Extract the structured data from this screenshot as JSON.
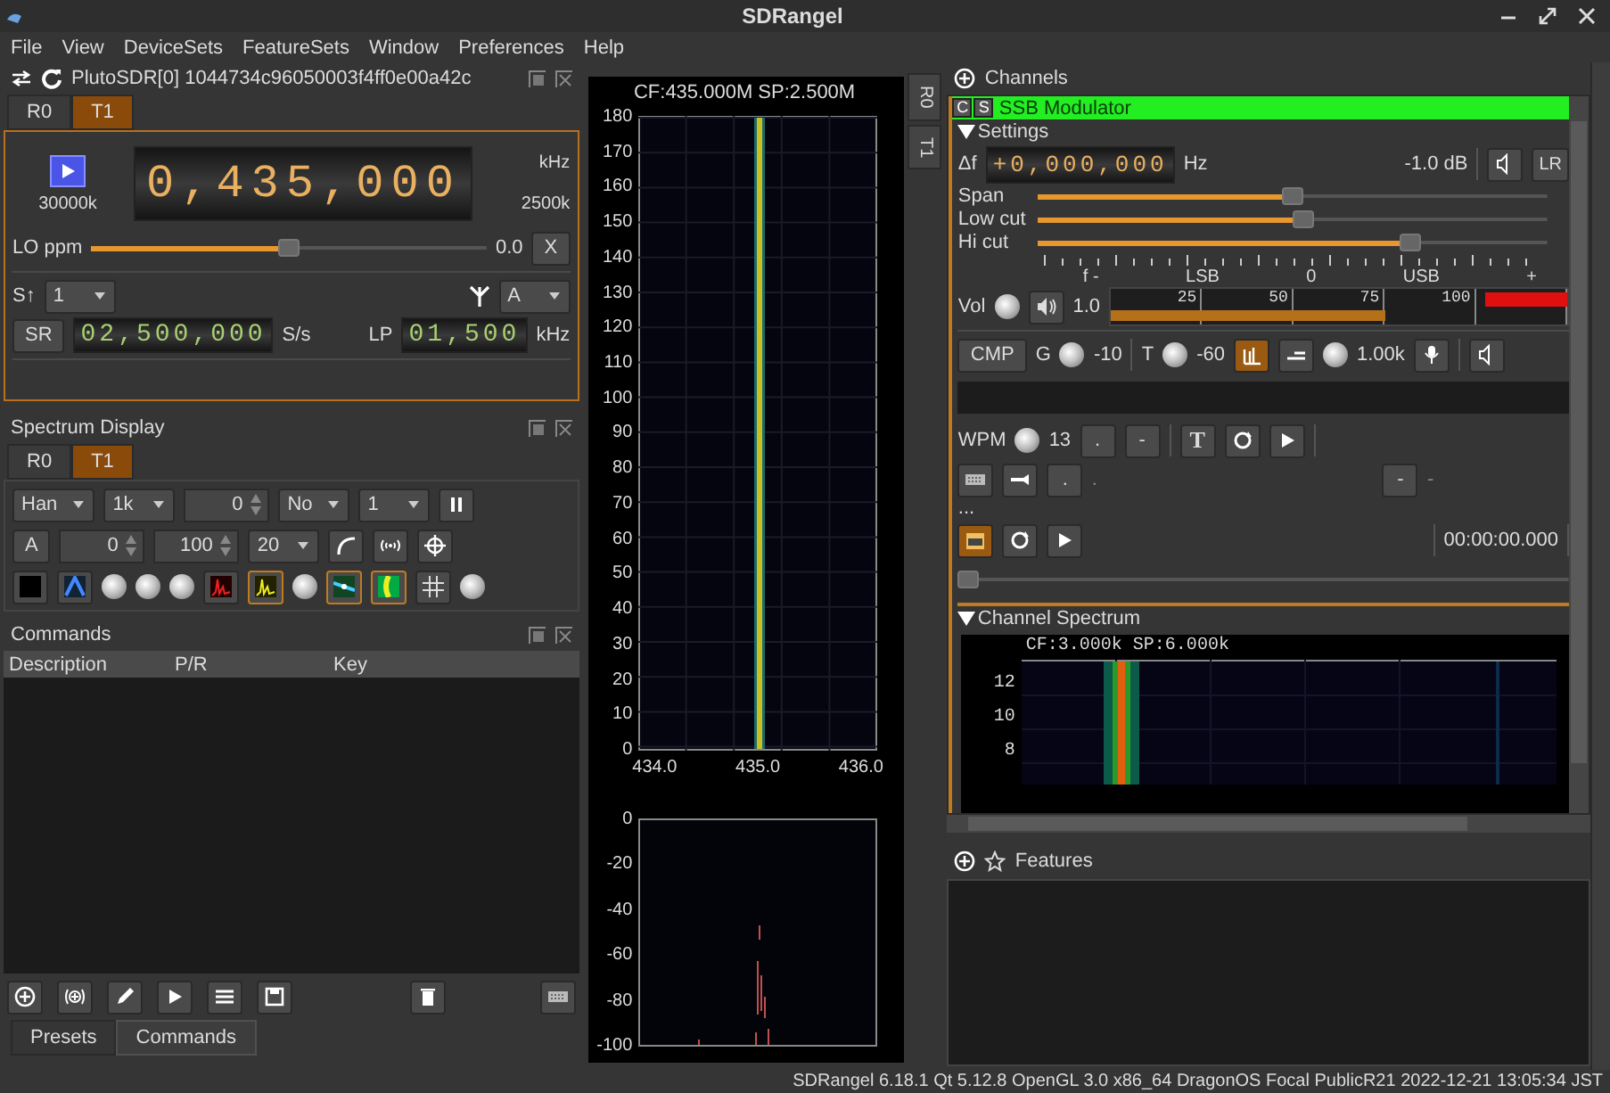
{
  "window": {
    "title": "SDRangel"
  },
  "menu": [
    "File",
    "View",
    "DeviceSets",
    "FeatureSets",
    "Window",
    "Preferences",
    "Help"
  ],
  "device": {
    "title": "PlutoSDR[0] 1044734c96050003f4ff0e00a42c",
    "tabs": [
      {
        "label": "R0",
        "selected": false
      },
      {
        "label": "T1",
        "selected": true
      }
    ],
    "frequency": "0,435,000",
    "frequency_unit": "kHz",
    "range_low": "30000k",
    "range_high": "2500k",
    "lo_ppm": {
      "label": "LO ppm",
      "level": 0.5,
      "reading": "0.0",
      "reset": "X"
    },
    "stream": {
      "label": "S↑",
      "value": "1"
    },
    "antenna": {
      "value": "A"
    },
    "sample_rate": {
      "button": "SR",
      "value": "02,500,000",
      "unit": "S/s"
    },
    "lowpass": {
      "label": "LP",
      "value": "01,500",
      "unit": "kHz"
    }
  },
  "spectrum_display": {
    "title": "Spectrum Display",
    "tabs": [
      {
        "label": "R0",
        "selected": false
      },
      {
        "label": "T1",
        "selected": true
      }
    ],
    "row_1": [
      {
        "kind": "dropdown",
        "value": "Han"
      },
      {
        "kind": "dropdown",
        "value": "1k"
      },
      {
        "kind": "spin",
        "value": "0"
      },
      {
        "kind": "dropdown",
        "value": "No"
      },
      {
        "kind": "dropdown",
        "value": "1"
      }
    ],
    "row_2": [
      {
        "kind": "button",
        "value": "A"
      },
      {
        "kind": "spin",
        "value": "0"
      },
      {
        "kind": "spin",
        "value": "100"
      },
      {
        "kind": "dropdown",
        "value": "20"
      }
    ]
  },
  "commands": {
    "title": "Commands",
    "columns": [
      "Description",
      "P/R",
      "Key"
    ]
  },
  "bottom_tabs": [
    {
      "label": "Presets",
      "selected": false
    },
    {
      "label": "Commands",
      "selected": true
    }
  ],
  "main_spectrum": {
    "caption": "CF:435.000M SP:2.500M",
    "waterfall_ticks": [
      "180",
      "170",
      "160",
      "150",
      "140",
      "130",
      "120",
      "110",
      "100",
      "90",
      "80",
      "70",
      "60",
      "50",
      "40",
      "30",
      "20",
      "10",
      "0"
    ],
    "frequency_ticks": [
      "434.0",
      "435.0",
      "436.0"
    ],
    "power_ticks": [
      "0",
      "-20",
      "-40",
      "-60",
      "-80",
      "-100"
    ]
  },
  "side_tabs": [
    "R0",
    "T1"
  ],
  "channels": {
    "title": "Channels",
    "modulator": {
      "badges": [
        "C",
        "S"
      ],
      "title": "SSB Modulator",
      "settings_label": "Settings",
      "delta_f": {
        "label": "Δf",
        "value": "+0,000,000",
        "unit": "Hz"
      },
      "gain_reading": "-1.0 dB",
      "lr_button": "LR",
      "sliders": [
        {
          "label": "Span",
          "level": 0.5
        },
        {
          "label": "Low cut",
          "level": 0.52
        },
        {
          "label": "Hi cut",
          "level": 0.74
        }
      ],
      "scale_labels": [
        "f -",
        "LSB",
        "0",
        "USB",
        "+"
      ],
      "volume": {
        "label": "Vol",
        "reading": "1.0",
        "level": 0.6,
        "meter_labels": [
          "25",
          "50",
          "75",
          "100"
        ]
      },
      "compressor": {
        "button": "CMP",
        "gain_label": "G",
        "gain": "-10",
        "threshold_label": "T",
        "threshold": "-60",
        "tone": "1.00k"
      },
      "morse": {
        "wpm_label": "WPM",
        "wpm": "13",
        "dot": ".",
        "dash": "-",
        "text_button": "T",
        "dot_2": ".",
        "dot_text": ".",
        "dash_2": "-",
        "dash_text": "-"
      },
      "file_label": "...",
      "time": "00:00:00.000",
      "file_position": {
        "level": 0
      },
      "spectrum_label": "Channel Spectrum",
      "spectrum_caption": "CF:3.000k SP:6.000k",
      "spectrum_ticks": [
        "12",
        "10",
        "8"
      ]
    }
  },
  "features": {
    "title": "Features"
  },
  "status_bar": "SDRangel 6.18.1 Qt 5.12.8 OpenGL 3.0 x86_64 DragonOS Focal PublicR21  2022-12-21 13:05:34 JST"
}
